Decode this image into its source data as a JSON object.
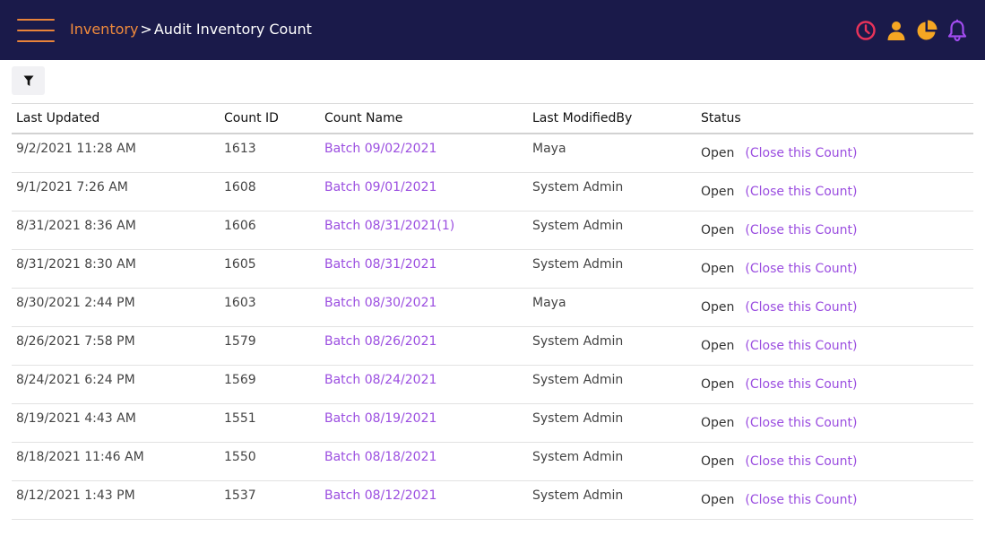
{
  "header": {
    "breadcrumb_parent": "Inventory",
    "breadcrumb_separator": ">",
    "breadcrumb_current": "Audit Inventory Count",
    "icons": [
      "clock-icon",
      "user-icon",
      "pie-chart-icon",
      "bell-icon"
    ],
    "colors": {
      "bar": "#1a1a4a",
      "accent": "#f08a3c",
      "clock": "#e8335a",
      "bell": "#a24cf0",
      "link": "#9b4ee0"
    }
  },
  "table": {
    "columns": [
      "Last Updated",
      "Count ID",
      "Count Name",
      "Last ModifiedBy",
      "Status"
    ],
    "rows": [
      {
        "updated": "9/2/2021 11:28 AM",
        "id": "1613",
        "name": "Batch 09/02/2021",
        "by": "Maya",
        "status": "Open",
        "action": "(Close this Count)"
      },
      {
        "updated": "9/1/2021 7:26 AM",
        "id": "1608",
        "name": "Batch 09/01/2021",
        "by": "System Admin",
        "status": "Open",
        "action": "(Close this Count)"
      },
      {
        "updated": "8/31/2021 8:36 AM",
        "id": "1606",
        "name": "Batch 08/31/2021(1)",
        "by": "System Admin",
        "status": "Open",
        "action": "(Close this Count)"
      },
      {
        "updated": "8/31/2021 8:30 AM",
        "id": "1605",
        "name": "Batch 08/31/2021",
        "by": "System Admin",
        "status": "Open",
        "action": "(Close this Count)"
      },
      {
        "updated": "8/30/2021 2:44 PM",
        "id": "1603",
        "name": "Batch 08/30/2021",
        "by": "Maya",
        "status": "Open",
        "action": "(Close this Count)"
      },
      {
        "updated": "8/26/2021 7:58 PM",
        "id": "1579",
        "name": "Batch 08/26/2021",
        "by": "System Admin",
        "status": "Open",
        "action": "(Close this Count)"
      },
      {
        "updated": "8/24/2021 6:24 PM",
        "id": "1569",
        "name": "Batch 08/24/2021",
        "by": "System Admin",
        "status": "Open",
        "action": "(Close this Count)"
      },
      {
        "updated": "8/19/2021 4:43 AM",
        "id": "1551",
        "name": "Batch 08/19/2021",
        "by": "System Admin",
        "status": "Open",
        "action": "(Close this Count)"
      },
      {
        "updated": "8/18/2021 11:46 AM",
        "id": "1550",
        "name": "Batch 08/18/2021",
        "by": "System Admin",
        "status": "Open",
        "action": "(Close this Count)"
      },
      {
        "updated": "8/12/2021 1:43 PM",
        "id": "1537",
        "name": "Batch 08/12/2021",
        "by": "System Admin",
        "status": "Open",
        "action": "(Close this Count)"
      }
    ]
  }
}
